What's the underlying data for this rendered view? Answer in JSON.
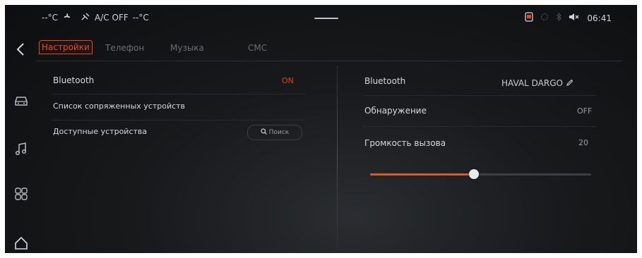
{
  "status_bar": {
    "temp_left": "--°C",
    "ac_label": "A/C OFF",
    "temp_right": "--°C",
    "clock": "06:41"
  },
  "tabs": [
    {
      "label": "Настройки",
      "active": true
    },
    {
      "label": "Телефон",
      "active": false
    },
    {
      "label": "Музыка",
      "active": false
    },
    {
      "label": "СМС",
      "active": false
    }
  ],
  "left_panel": {
    "bluetooth_label": "Bluetooth",
    "bluetooth_value": "ON",
    "paired_devices_label": "Список сопряженных устройств",
    "available_devices_label": "Доступные устройства",
    "search_label": "Поиск"
  },
  "right_panel": {
    "bluetooth_label": "Bluetooth",
    "device_name": "HAVAL DARGO",
    "discovery_label": "Обнаружение",
    "discovery_value": "OFF",
    "call_volume_label": "Громкость вызова",
    "call_volume_value": "20",
    "call_volume_fraction": 0.47
  },
  "colors": {
    "accent": "#e64a19",
    "on_value": "#e0431c",
    "background": "#141618"
  },
  "icons": {
    "sidebar": [
      "back-icon",
      "car-icon",
      "music-icon",
      "apps-grid-icon",
      "home-icon"
    ],
    "status": [
      "fan-icon",
      "ac-icon",
      "phone-icon",
      "wifi-icon",
      "bluetooth-icon",
      "mute-icon"
    ]
  }
}
